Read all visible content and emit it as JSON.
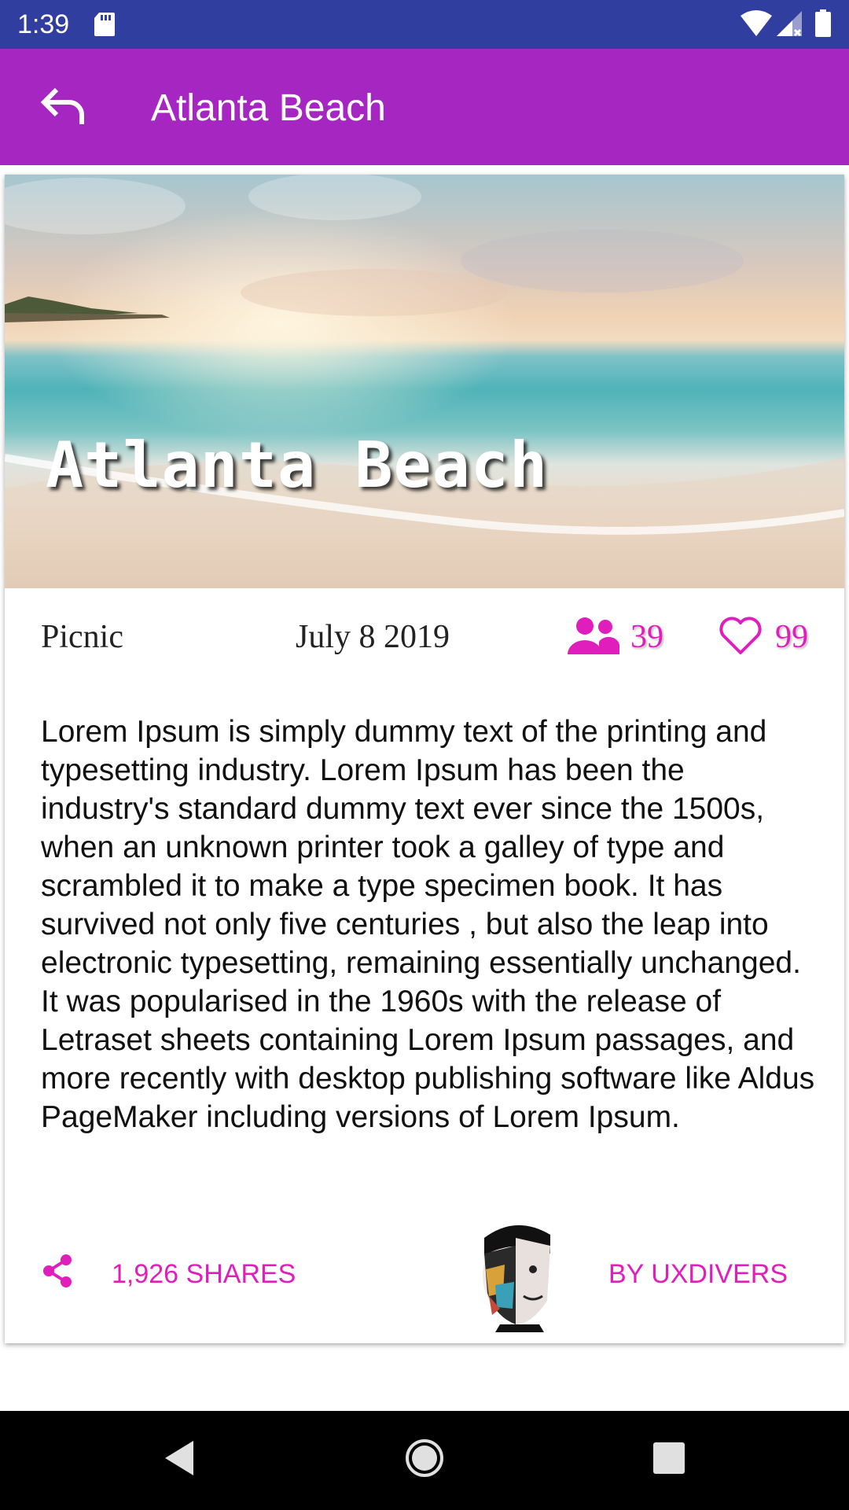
{
  "status_bar": {
    "time": "1:39",
    "icons": [
      "sd-card-icon",
      "wifi-icon",
      "signal-icon",
      "battery-icon"
    ]
  },
  "app_bar": {
    "title": "Atlanta Beach",
    "back_icon": "back-arrow-icon",
    "background": "#A626C2"
  },
  "card": {
    "hero_title": "Atlanta Beach",
    "category": "Picnic",
    "date": "July 8 2019",
    "attendees": "39",
    "likes": "99",
    "description": "Lorem Ipsum is simply dummy text of the printing and typesetting industry. Lorem Ipsum has been the industry's standard dummy text ever since the 1500s, when an unknown printer took a galley of type and scrambled it to make a type specimen book. It has survived not only five centuries , but also the leap into electronic typesetting, remaining essentially unchanged. It was popularised in the 1960s with the release of Letraset sheets containing Lorem Ipsum passages, and more recently with desktop publishing software like Aldus PageMaker including versions of Lorem Ipsum.",
    "shares": "1,926 SHARES",
    "author": "BY UXDIVERS",
    "accent": "#E01EBB"
  },
  "nav_bar": {
    "icons": [
      "nav-back-icon",
      "nav-home-icon",
      "nav-recents-icon"
    ]
  }
}
